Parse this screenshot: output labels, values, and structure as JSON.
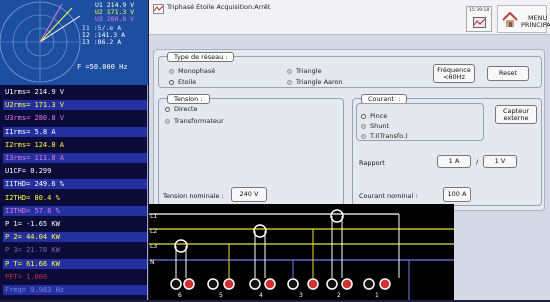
{
  "phasor": {
    "u1": "U1 214.9 V",
    "u2": "U2 171.3 V",
    "u3": "U3 280.8 V",
    "i1": "I1 :5/.e A",
    "i2": "I2 :141.3 A",
    "i3": "I3 :86.2 A",
    "freq": "F  =50.000 Hz"
  },
  "measurements": [
    {
      "text": "U1rms= 214.9 V",
      "color": "#ffffff"
    },
    {
      "text": "U2rms= 171.3 V",
      "color": "#ffff40"
    },
    {
      "text": "U3rms= 280.8 V",
      "color": "#e07ae0"
    },
    {
      "text": "I1rms= 5.8 A",
      "color": "#ffffff"
    },
    {
      "text": "I2rms= 124.8 A",
      "color": "#ffff40"
    },
    {
      "text": "I3rms= 111.8 A",
      "color": "#e07ae0"
    },
    {
      "text": "U1CF= 0.299",
      "color": "#ffffff"
    },
    {
      "text": "I1THD= 249.6 %",
      "color": "#ffffff"
    },
    {
      "text": "I2THD= 80.4 %",
      "color": "#ffff40"
    },
    {
      "text": "I3THD= 57.8 %",
      "color": "#e07ae0"
    },
    {
      "text": "P 1= -1.65 KW",
      "color": "#ffffff"
    },
    {
      "text": "P 2= 44.04 KW",
      "color": "#ffff40"
    },
    {
      "text": "P 3= 21.78 KW",
      "color": "#7a64c8"
    },
    {
      "text": "P T= 61.66 KW",
      "color": "#ffff40"
    },
    {
      "text": "PFT= 1.000",
      "color": "#c03050"
    },
    {
      "text": "Freq= 9.983 Hz",
      "color": "#6a8ae0"
    }
  ],
  "topbar": {
    "status": "Triphasé Etoile Acquisition:Arrêt",
    "clock": "15:39:18",
    "menu_label": "MENU\nPRINCIPAL"
  },
  "network": {
    "title": "Type de réseau :",
    "options": [
      "Monophasé",
      "Etoile",
      "Triangle",
      "Triangle Aaron"
    ],
    "frequency_button": "Fréquence\n<60Hz",
    "reset_button": "Reset"
  },
  "voltage": {
    "title": "Tension :",
    "options": [
      "Directe",
      "Transformateur"
    ],
    "nominal_label": "Tension nominale :",
    "nominal_value": "240 V"
  },
  "current": {
    "title": "Courant",
    "options": [
      "Pince",
      "Shunt",
      "T.I(Transfo.)"
    ],
    "sensor_button": "Capteur\nexterne",
    "ratio_label": "Rapport",
    "ratio_a": "1 A",
    "ratio_sep": "/",
    "ratio_b": "1 V",
    "nominal_label": "Courant nominal :",
    "nominal_value": "100 A"
  },
  "wiring": {
    "line_labels": [
      "L1",
      "L2",
      "L3",
      "N"
    ],
    "terminal_labels": [
      "6",
      "5",
      "4",
      "3",
      "2",
      "1"
    ],
    "colors": {
      "l1": "#ffffff",
      "l2": "#f0e030",
      "l3": "#e0e040",
      "n": "#7a7ae8"
    }
  }
}
